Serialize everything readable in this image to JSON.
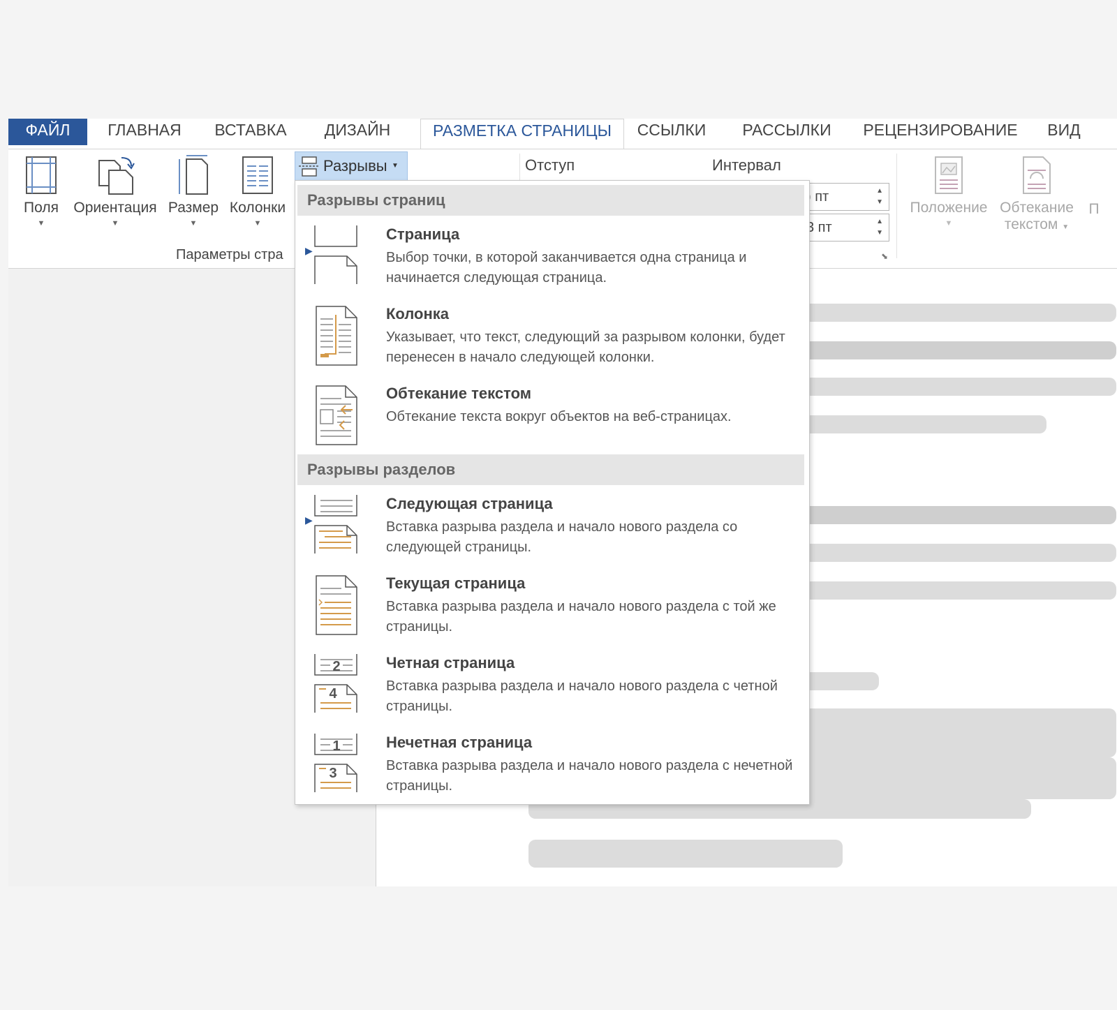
{
  "tabs": [
    "ФАЙЛ",
    "ГЛАВНАЯ",
    "ВСТАВКА",
    "ДИЗАЙН",
    "РАЗМЕТКА СТРАНИЦЫ",
    "ССЫЛКИ",
    "РАССЫЛКИ",
    "РЕЦЕНЗИРОВАНИЕ",
    "ВИД"
  ],
  "ribbon": {
    "fields_label": "Поля",
    "orientation_label": "Ориентация",
    "size_label": "Размер",
    "columns_label": "Колонки",
    "breaks_label": "Разрывы",
    "page_setup_group": "Параметры стра",
    "indent_label": "Отступ",
    "spacing_label": "Интервал",
    "spacing_before": ") пт",
    "spacing_after": "3 пт",
    "position_label": "Положение",
    "wrap_label_1": "Обтекание",
    "wrap_label_2": "текстом",
    "truncated_label": "П"
  },
  "menu": {
    "page_breaks_header": "Разрывы страниц",
    "section_breaks_header": "Разрывы разделов",
    "items": [
      {
        "title": "Страница",
        "desc": "Выбор точки, в которой заканчивается одна страница и начинается следующая страница."
      },
      {
        "title": "Колонка",
        "desc": "Указывает, что текст, следующий за разрывом колонки, будет перенесен в начало следующей колонки."
      },
      {
        "title": "Обтекание текстом",
        "desc": "Обтекание текста вокруг объектов на веб-страницах."
      },
      {
        "title": "Следующая страница",
        "desc": "Вставка разрыва раздела и начало нового раздела со следующей страницы."
      },
      {
        "title": "Текущая страница",
        "desc": "Вставка разрыва раздела и начало нового раздела с той же страницы."
      },
      {
        "title": "Четная страница",
        "desc": "Вставка разрыва раздела и начало нового раздела с четной страницы."
      },
      {
        "title": "Нечетная страница",
        "desc": "Вставка разрыва раздела и начало нового раздела с нечетной страницы."
      }
    ],
    "icon_numbers": {
      "even_top": "2",
      "even_bottom": "4",
      "odd_top": "1",
      "odd_bottom": "3"
    }
  },
  "colors": {
    "accent": "#2b579a",
    "icon_orange": "#d49a4a",
    "breaks_highlight": "#c5dcf4"
  }
}
